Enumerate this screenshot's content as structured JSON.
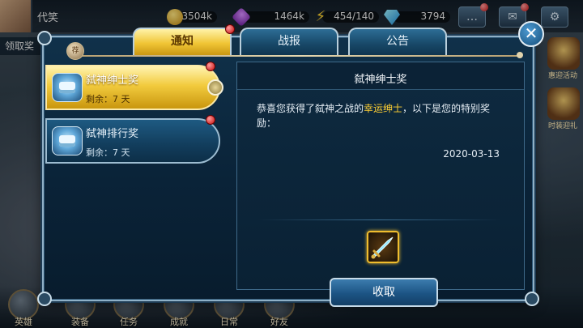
{
  "topbar": {
    "player_name": "代笑",
    "gold": "3504k",
    "gem": "1464k",
    "energy": "454/140",
    "diamond": "3794"
  },
  "side": {
    "left_label": "领取奖",
    "right_labels": [
      "惠迎活动",
      "时装迎礼"
    ]
  },
  "bottom_nav": [
    "英雄",
    "装备",
    "任务",
    "成就",
    "日常",
    "好友"
  ],
  "dialog": {
    "badge": "荐",
    "tabs": [
      {
        "label": "通知",
        "active": true
      },
      {
        "label": "战报",
        "active": false
      },
      {
        "label": "公告",
        "active": false
      }
    ],
    "close_symbol": "✕",
    "list": [
      {
        "title": "弑神绅士奖",
        "remain": "剩余：7 天",
        "selected": true
      },
      {
        "title": "弑神排行奖",
        "remain": "剩余：7 天",
        "selected": false
      }
    ],
    "detail": {
      "title": "弑神绅士奖",
      "text_before": "恭喜您获得了弑神之战的",
      "text_highlight": "幸运绅士",
      "text_after": "，以下是您的特别奖励：",
      "date": "2020-03-13",
      "reward_icon": "sword-icon",
      "claim_label": "收取"
    }
  },
  "colors": {
    "active_tab": "#f0c535",
    "highlight_text": "#ffcf33",
    "notification_dot": "#c40d0d"
  }
}
